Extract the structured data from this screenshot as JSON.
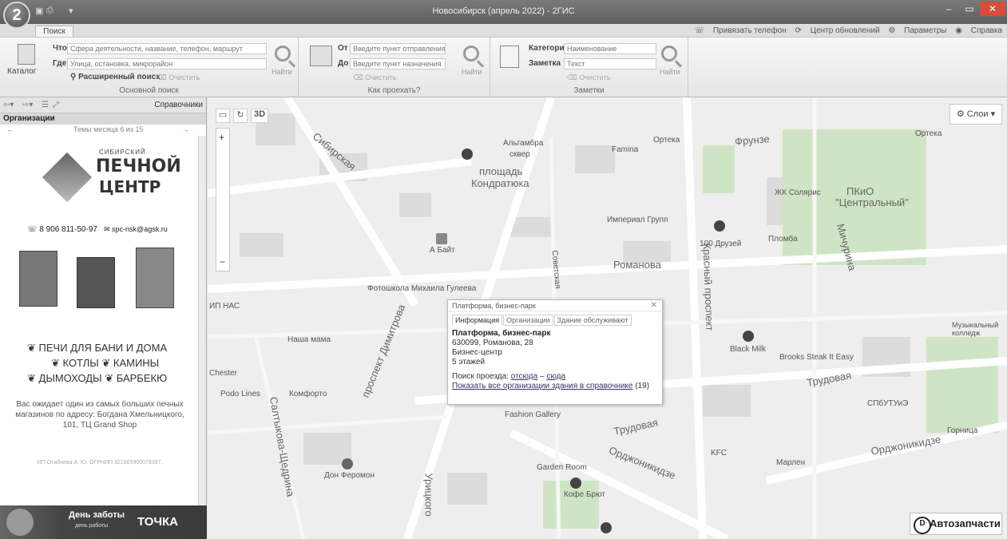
{
  "window": {
    "title": "Новосибирск (апрель 2022) - 2ГИС",
    "logo": "2",
    "minimize": "–",
    "maximize": "▭",
    "close": "✕"
  },
  "tabs": {
    "search": "Поиск"
  },
  "top_links": {
    "phone": "Привязать телефон",
    "updates": "Центр обновлений",
    "params": "Параметры",
    "help": "Справка"
  },
  "main_search": {
    "catalog_label": "Каталог",
    "what_label": "Что",
    "what_placeholder": "Сфера деятельности, название, телефон, маршрут",
    "where_label": "Где",
    "where_placeholder": "Улица, остановка, микрорайон",
    "advanced": "Расширенный поиск",
    "clear": "Очистить",
    "find": "Найти",
    "group_label": "Основной поиск"
  },
  "route": {
    "from_label": "От",
    "from_placeholder": "Введите пункт отправления",
    "to_label": "До",
    "to_placeholder": "Введите пункт назначения",
    "clear": "Очистить",
    "find": "Найти",
    "group_label": "Как проехать?"
  },
  "notes": {
    "category_label": "Категория",
    "category_placeholder": "Наименование",
    "note_label": "Заметка",
    "note_placeholder": "Текст",
    "clear": "Очистить",
    "find": "Найти",
    "group_label": "Заметки"
  },
  "sidebar": {
    "directories": "Справочники",
    "organizations": "Организации",
    "theme_nav": "Темы месяца 6 из 15",
    "prev": "←",
    "next": "→",
    "ad": {
      "brand_top": "СИБИРСКИЙ",
      "brand_mid": "ПЕЧНОЙ",
      "brand_bottom": "ЦЕНТР",
      "phone": "8 906 811-50-97",
      "email": "spc-nsk@agsk.ru",
      "line1": "ПЕЧИ ДЛЯ БАНИ И ДОМА",
      "line2": "КОТЛЫ",
      "line2b": "КАМИНЫ",
      "line3": "ДЫМОХОДЫ",
      "line3b": "БАРБЕКЮ",
      "desc": "Вас ожидает один из самых больших печных магазинов по адресу: Богдана Хмельницкого, 101, ТЦ Grand Shop",
      "legal": "ИП Отибнева А. Ю. ОГРНИП 321665900079397."
    },
    "banner": {
      "left": "День заботы",
      "left_sub": "день работы",
      "right": "ТОЧКА"
    }
  },
  "map": {
    "view_3d": "3D",
    "layers": "Слои",
    "autoparts": "Автозапчасти",
    "labels": {
      "square": "площадь",
      "kondratyuk": "Кондратюка",
      "alhambra": "Альгамбра",
      "skver": "сквер",
      "imperial": "Империал Групп",
      "romanova": "Романова",
      "sovetskaya": "Советская",
      "krasny": "Красный проспект",
      "dimitrova": "проспект Димитрова",
      "trudovaya": "Трудовая",
      "ordzhonikidze": "Орджоникидзе",
      "nasha_mama": "Наша мама",
      "komforto": "Комфорто",
      "podo_lines": "Podo Lines",
      "don_feromon": "Дон Феромон",
      "fashion": "Fashion Gallery",
      "garden": "Garden Room",
      "kofe": "Кофе Брют",
      "black_milk": "Black Milk",
      "brooks": "Brooks Steak It Easy",
      "kfc": "KFC",
      "marlen": "Марлен",
      "sto_druzey": "100 Друзей",
      "plomba": "Пломба",
      "zhk_solaris": "ЖК Солярис",
      "pkio": "ПКиО",
      "centralny": "\"Центральный\"",
      "muz_college": "Музыкальный колледж",
      "orteka": "Ортека",
      "famina": "Famina",
      "fotoshkola": "Фотошкола Михаила Гулеева",
      "a_bait": "А Байт",
      "sibirskaya": "Сибирская",
      "frunze": "Фрунзе",
      "michurina": "Мичурина",
      "saltykova": "Салтыкова-Щедрина",
      "urickogo": "Урицкого",
      "chester": "Chester",
      "gorica": "Горница",
      "sbtu": "СПбУТУиЭ",
      "pas": "ИП НАС"
    },
    "popup": {
      "title": "Платформа, бизнес-парк",
      "tab_info": "Информация",
      "tab_orgs": "Организации",
      "tab_building": "Здание обслуживают",
      "name": "Платформа, бизнес-парк",
      "address": "630099, Романова, 28",
      "type": "Бизнес-центр",
      "floors": "5 этажей",
      "route_label": "Поиск проезда:",
      "from_here": "отсюда",
      "dash": "–",
      "to_here": "сюда",
      "show_all": "Показать все организации здания в справочнике",
      "count": "(19)"
    }
  }
}
